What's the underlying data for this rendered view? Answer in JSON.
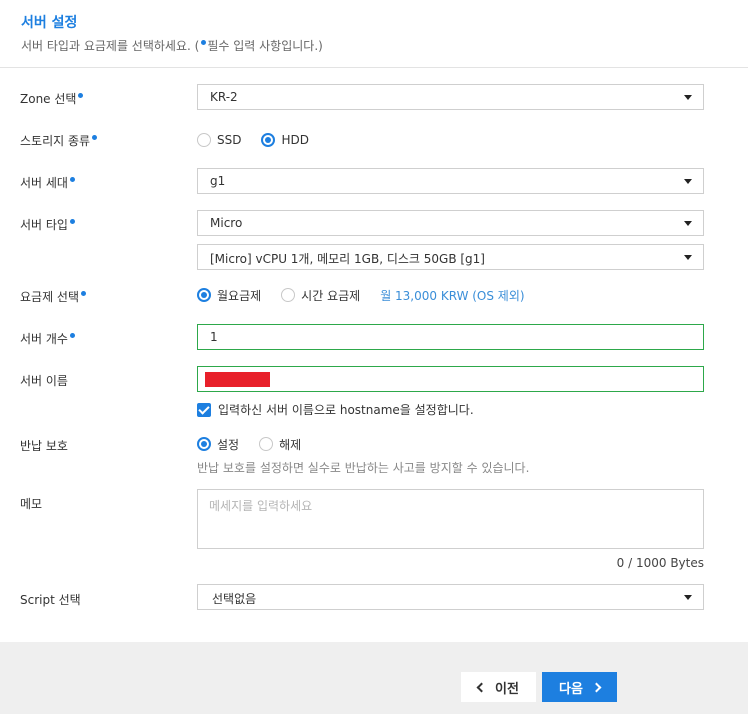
{
  "header": {
    "title": "서버 설정",
    "subtitle_before": "서버 타입과 요금제를 선택하세요. (",
    "subtitle_after": "필수 입력 사항입니다.)"
  },
  "colors": {
    "accent": "#1d7fe0",
    "valid_border": "#2da84a",
    "redaction": "#e8202a"
  },
  "zone": {
    "label": "Zone 선택",
    "value": "KR-2"
  },
  "storage": {
    "label": "스토리지 종류",
    "options": [
      "SSD",
      "HDD"
    ],
    "selected": "HDD"
  },
  "generation": {
    "label": "서버 세대",
    "value": "g1"
  },
  "server_type": {
    "label": "서버 타입",
    "value": "Micro",
    "spec_value": "[Micro] vCPU 1개, 메모리 1GB, 디스크 50GB [g1]"
  },
  "plan": {
    "label": "요금제 선택",
    "options": [
      "월요금제",
      "시간 요금제"
    ],
    "selected": "월요금제",
    "price": "월 13,000 KRW (OS 제외)"
  },
  "count": {
    "label": "서버 개수",
    "value": "1"
  },
  "name": {
    "label": "서버 이름",
    "hostname_checkbox": "입력하신 서버 이름으로 hostname을 설정합니다."
  },
  "return_protection": {
    "label": "반납 보호",
    "options": [
      "설정",
      "해제"
    ],
    "selected": "설정",
    "help": "반납 보호를 설정하면 실수로 반납하는 사고를 방지할 수 있습니다."
  },
  "memo": {
    "label": "메모",
    "placeholder": "메세지를 입력하세요",
    "bytes": "0 / 1000 Bytes"
  },
  "script": {
    "label": "Script 선택",
    "value": "선택없음"
  },
  "footer": {
    "prev_label": "이전",
    "next_label": "다음"
  }
}
